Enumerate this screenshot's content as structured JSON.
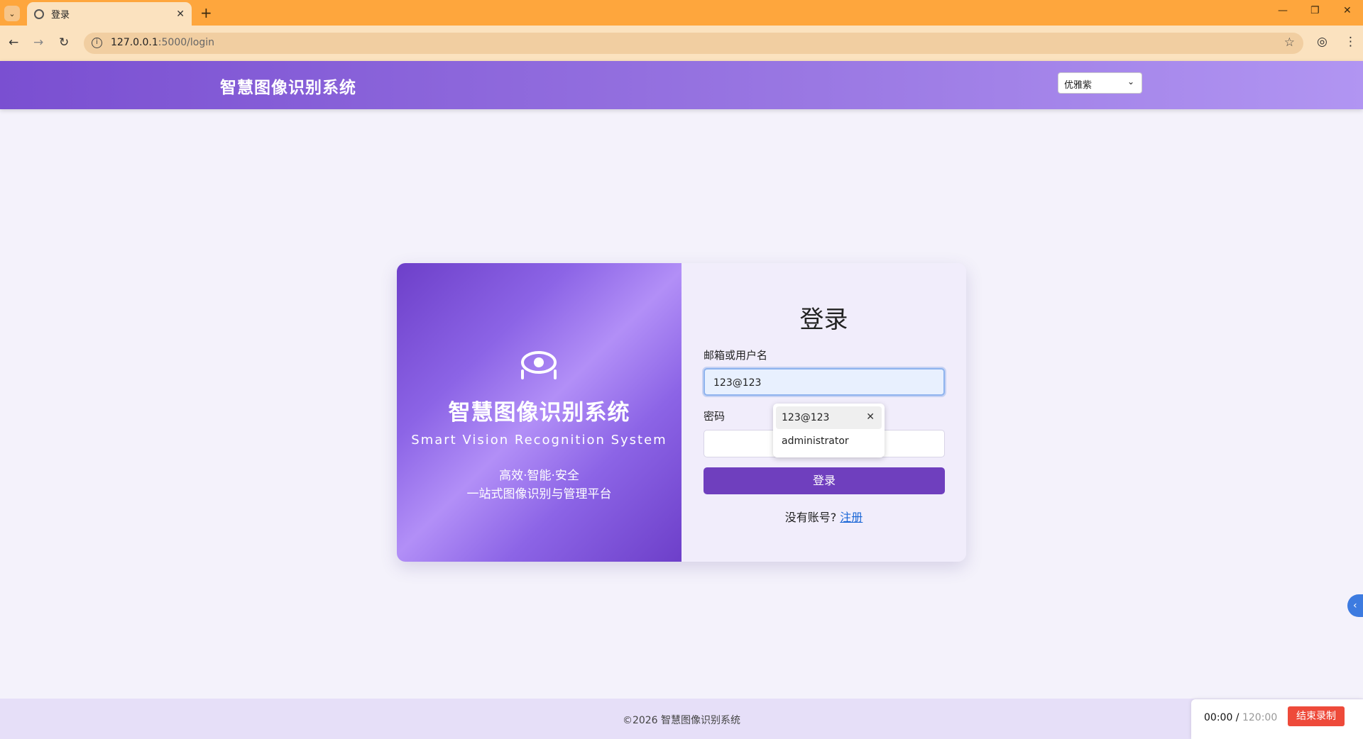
{
  "browser": {
    "tab_title": "登录",
    "url_host": "127.0.0.1",
    "url_path": ":5000/login"
  },
  "header": {
    "site_title": "智慧图像识别系统",
    "theme_selected": "优雅紫"
  },
  "brand": {
    "title_cn": "智慧图像识别系统",
    "title_en": "Smart Vision Recognition System",
    "slogan_line1": "高效·智能·安全",
    "slogan_line2": "一站式图像识别与管理平台"
  },
  "login": {
    "title": "登录",
    "username_label": "邮箱或用户名",
    "username_value": "123@123",
    "password_label": "密码",
    "password_value": "",
    "submit_label": "登录",
    "no_account_text": "没有账号?",
    "register_link": "注册"
  },
  "autocomplete": {
    "items": [
      "123@123",
      "administrator"
    ]
  },
  "footer": {
    "copyright": "©2026 智慧图像识别系统"
  },
  "recorder": {
    "elapsed": "00:00",
    "separator": " / ",
    "total": "120:00",
    "stop_label": "结束录制"
  },
  "colors": {
    "tabstrip": "#fea63d",
    "header_gradient_start": "#7a4fd1",
    "accent_purple": "#6f3fbe",
    "link_blue": "#1a66d6",
    "stop_red": "#ee4a3a"
  }
}
